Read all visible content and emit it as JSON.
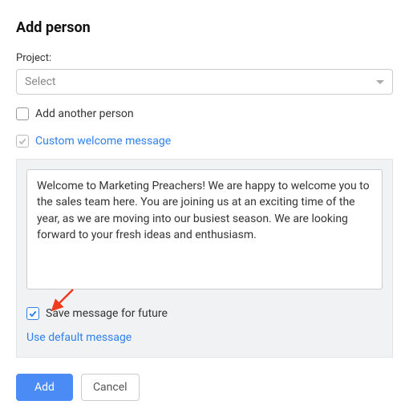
{
  "title": "Add person",
  "project": {
    "label": "Project:",
    "selected": "Select"
  },
  "add_another": {
    "label": "Add another person",
    "checked": false
  },
  "custom_welcome": {
    "label": "Custom welcome message",
    "checked": true
  },
  "message": {
    "value": "Welcome to Marketing Preachers! We are happy to welcome you to the sales team here. You are joining us at an exciting time of the year, as we are moving into our busiest season. We are looking forward to your fresh ideas and enthusiasm."
  },
  "save_for_future": {
    "label": "Save message for future",
    "checked": true
  },
  "use_default_label": "Use default message",
  "buttons": {
    "add": "Add",
    "cancel": "Cancel"
  },
  "colors": {
    "accent": "#2F80ED",
    "arrow": "#F13A1E"
  }
}
